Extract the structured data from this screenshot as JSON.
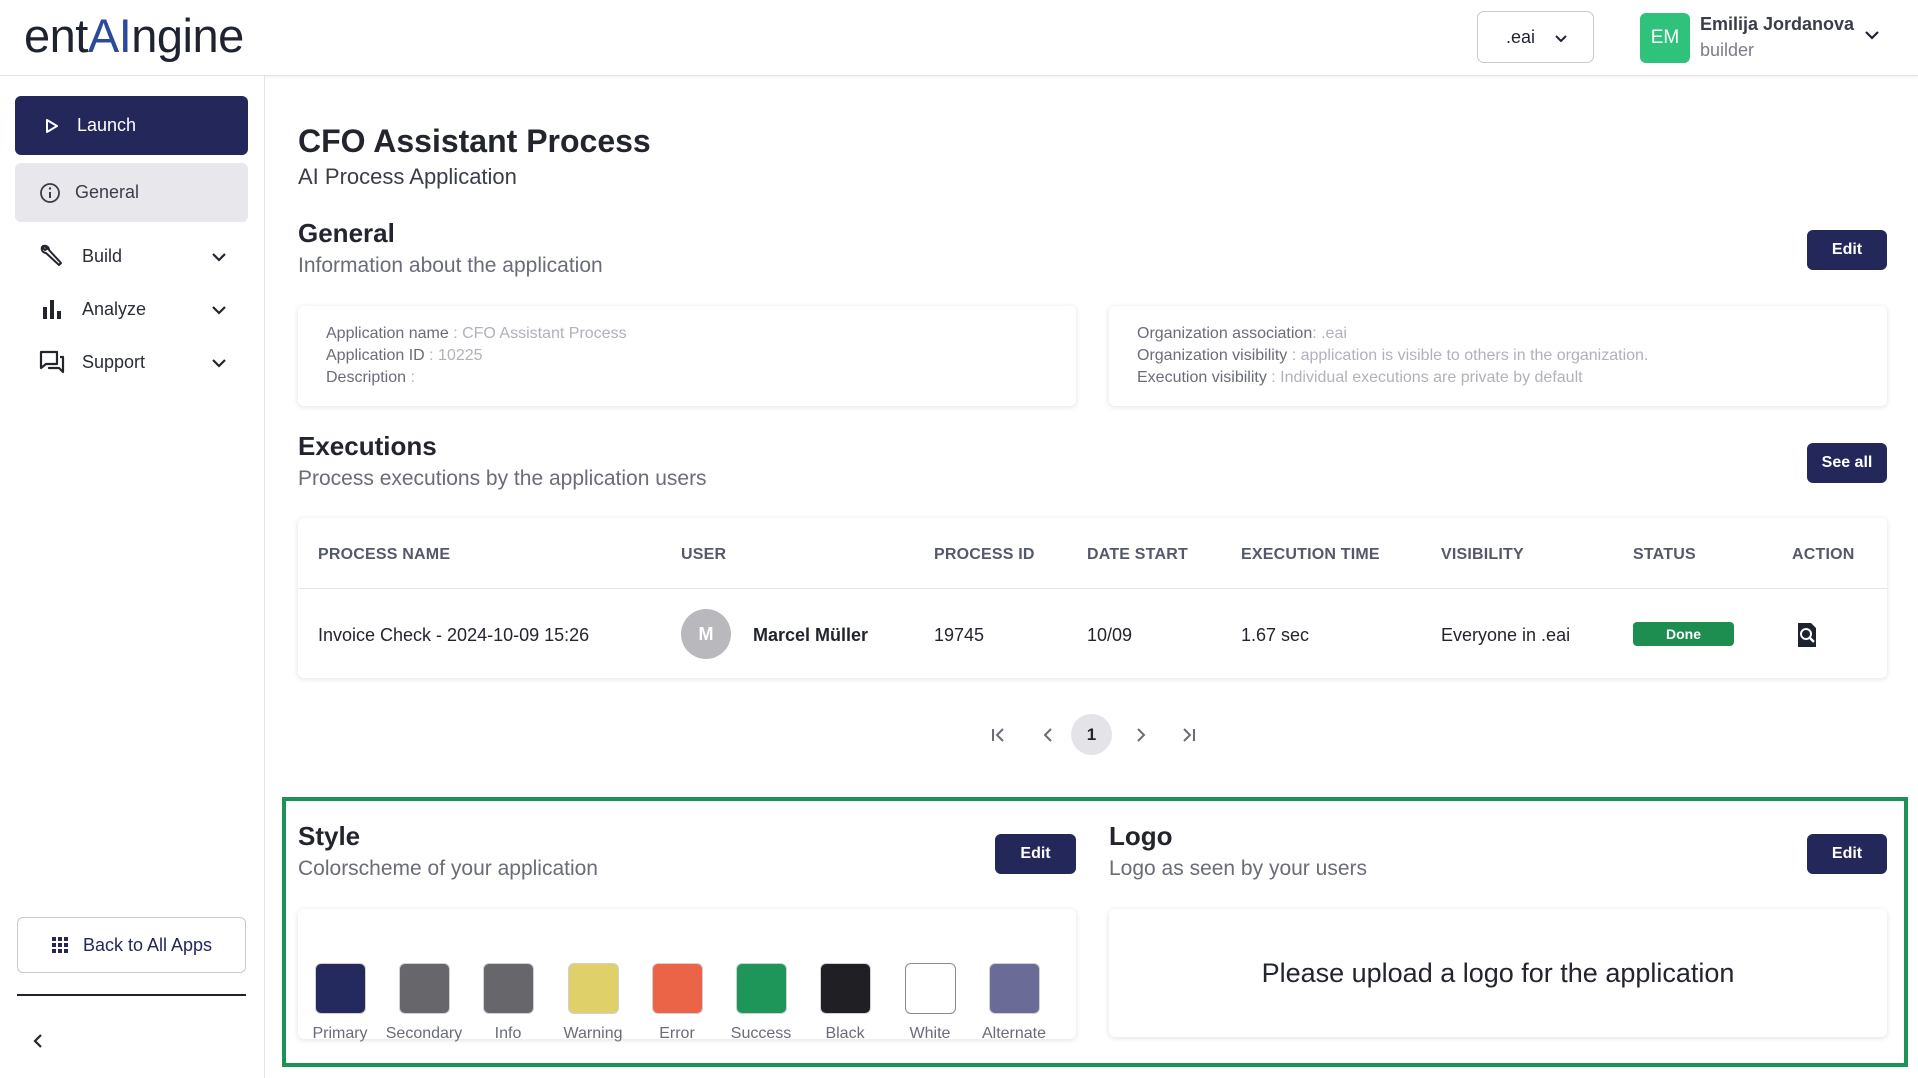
{
  "header": {
    "logo_prefix": "ent",
    "logo_ai": "AI",
    "logo_suffix": "ngine",
    "org_select_value": ".eai",
    "user_initials": "EM",
    "user_name": "Emilija Jordanova",
    "user_role": "builder"
  },
  "sidebar": {
    "launch_label": "Launch",
    "general_label": "General",
    "items": [
      {
        "label": "Build",
        "icon": "wrench-icon"
      },
      {
        "label": "Analyze",
        "icon": "bar-chart-icon"
      },
      {
        "label": "Support",
        "icon": "chat-icon"
      }
    ],
    "back_label": "Back to All Apps"
  },
  "page": {
    "title": "CFO Assistant Process",
    "subtitle": "AI Process Application"
  },
  "general": {
    "title": "General",
    "subtitle": "Information about the application",
    "edit_label": "Edit",
    "app_name_key": "Application name",
    "app_name_val": " : CFO Assistant Process",
    "app_id_key": "Application ID",
    "app_id_val": " : 10225",
    "desc_key": "Description",
    "desc_val": " :",
    "org_assoc_key": "Organization association",
    "org_assoc_val": ": .eai",
    "org_vis_key": "Organization visibility",
    "org_vis_val": " : application is visible to others in the organization.",
    "exec_vis_key": "Execution visibility",
    "exec_vis_val": " : Individual executions are private by default"
  },
  "executions": {
    "title": "Executions",
    "subtitle": "Process executions by the application users",
    "see_all_label": "See all",
    "columns": [
      "PROCESS NAME",
      "USER",
      "PROCESS ID",
      "DATE START",
      "EXECUTION TIME",
      "VISIBILITY",
      "STATUS",
      "ACTION"
    ],
    "rows": [
      {
        "process_name": "Invoice Check - 2024-10-09 15:26",
        "user_initial": "M",
        "user": "Marcel Müller",
        "process_id": "19745",
        "date_start": "10/09",
        "execution_time": "1.67 sec",
        "visibility": "Everyone in .eai",
        "status": "Done",
        "action_icon": "search-document-icon"
      }
    ],
    "current_page": "1"
  },
  "style": {
    "title": "Style",
    "subtitle": "Colorscheme of your application",
    "edit_label": "Edit",
    "swatches": [
      {
        "label": "Primary",
        "color": "#252a5e"
      },
      {
        "label": "Secondary",
        "color": "#67676b"
      },
      {
        "label": "Info",
        "color": "#67676b"
      },
      {
        "label": "Warning",
        "color": "#e0d06a"
      },
      {
        "label": "Error",
        "color": "#ec6448"
      },
      {
        "label": "Success",
        "color": "#1e9559"
      },
      {
        "label": "Black",
        "color": "#1f1f24"
      },
      {
        "label": "White",
        "color": "#ffffff"
      },
      {
        "label": "Alternate",
        "color": "#6a6b96"
      }
    ]
  },
  "logo_section": {
    "title": "Logo",
    "subtitle": "Logo as seen by your users",
    "edit_label": "Edit",
    "empty_message": "Please upload a logo for the application"
  }
}
